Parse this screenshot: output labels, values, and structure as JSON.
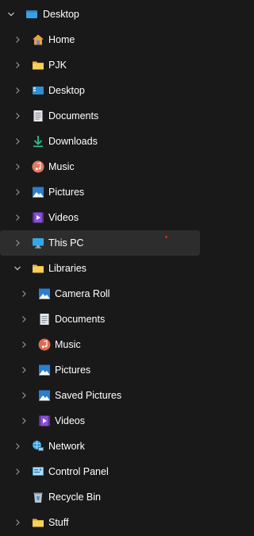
{
  "nav_tree": {
    "items": [
      {
        "label": "Desktop",
        "icon": "desktop-folder-icon",
        "expanded": true
      },
      {
        "label": "Home",
        "icon": "home-icon"
      },
      {
        "label": "PJK",
        "icon": "folder-icon"
      },
      {
        "label": "Desktop",
        "icon": "desktop-icon"
      },
      {
        "label": "Documents",
        "icon": "documents-icon"
      },
      {
        "label": "Downloads",
        "icon": "downloads-icon"
      },
      {
        "label": "Music",
        "icon": "music-icon"
      },
      {
        "label": "Pictures",
        "icon": "pictures-icon"
      },
      {
        "label": "Videos",
        "icon": "videos-icon"
      },
      {
        "label": "This PC",
        "icon": "this-pc-icon",
        "selected": true
      },
      {
        "label": "Libraries",
        "icon": "folder-icon",
        "expanded": true
      },
      {
        "label": "Camera Roll",
        "icon": "pictures-icon"
      },
      {
        "label": "Documents",
        "icon": "documents-icon"
      },
      {
        "label": "Music",
        "icon": "music-icon"
      },
      {
        "label": "Pictures",
        "icon": "pictures-icon"
      },
      {
        "label": "Saved Pictures",
        "icon": "pictures-icon"
      },
      {
        "label": "Videos",
        "icon": "videos-icon"
      },
      {
        "label": "Network",
        "icon": "network-icon"
      },
      {
        "label": "Control Panel",
        "icon": "control-panel-icon"
      },
      {
        "label": "Recycle Bin",
        "icon": "recycle-bin-icon"
      },
      {
        "label": "Stuff",
        "icon": "folder-icon"
      }
    ]
  },
  "colors": {
    "background": "#191919",
    "selected_row": "#2d2d2d",
    "folder_yellow": "#f4c542",
    "accent_blue": "#3aa0e6"
  }
}
